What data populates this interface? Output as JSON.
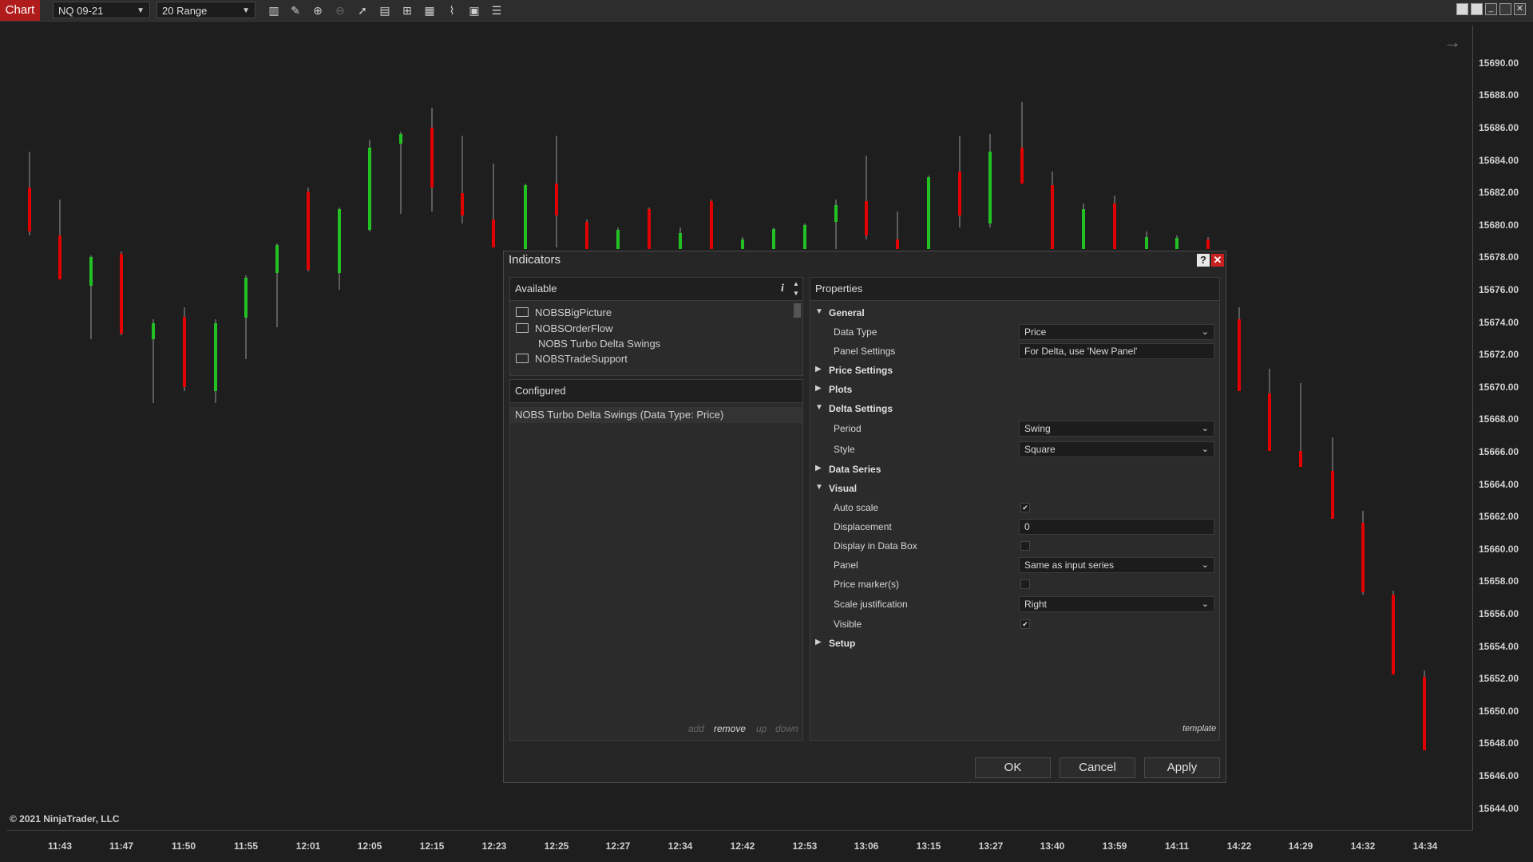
{
  "toolbar": {
    "chart_tab": "Chart",
    "instrument": "NQ 09-21",
    "interval": "20 Range",
    "icons": [
      "bars-icon",
      "draw-pencil-icon",
      "zoom-in-icon",
      "zoom-out-icon",
      "pointer-icon",
      "data-box-icon",
      "properties-icon",
      "indicators-icon",
      "strategies-icon",
      "templates-icon",
      "list-icon"
    ]
  },
  "chart": {
    "copyright": "© 2021 NinjaTrader, LLC",
    "up_color": "#22c022",
    "down_color": "#e00000",
    "price_labels": [
      "15690.00",
      "15688.00",
      "15686.00",
      "15684.00",
      "15682.00",
      "15680.00",
      "15678.00",
      "15676.00",
      "15674.00",
      "15672.00",
      "15670.00",
      "15668.00",
      "15666.00",
      "15664.00",
      "15662.00",
      "15660.00",
      "15658.00",
      "15656.00",
      "15654.00",
      "15652.00",
      "15650.00",
      "15648.00",
      "15646.00",
      "15644.00"
    ],
    "time_labels": [
      "11:43",
      "11:47",
      "11:50",
      "11:55",
      "12:01",
      "12:05",
      "12:15",
      "12:23",
      "12:25",
      "12:27",
      "12:34",
      "12:42",
      "12:53",
      "13:06",
      "13:15",
      "13:27",
      "13:40",
      "13:59",
      "14:11",
      "14:22",
      "14:29",
      "14:32",
      "14:34"
    ]
  },
  "dialog": {
    "title": "Indicators",
    "help": "?",
    "close": "✕",
    "available": {
      "header": "Available",
      "info": "i",
      "items": [
        {
          "label": "NOBSBigPicture",
          "folder": true
        },
        {
          "label": "NOBSOrderFlow",
          "folder": true
        },
        {
          "label": "NOBS Turbo Delta Swings",
          "folder": false
        },
        {
          "label": "NOBSTradeSupport",
          "folder": true
        }
      ]
    },
    "configured": {
      "header": "Configured",
      "items": [
        "NOBS Turbo Delta Swings (Data Type: Price)"
      ],
      "actions": {
        "add": "add",
        "remove": "remove",
        "up": "up",
        "down": "down"
      }
    },
    "properties": {
      "header": "Properties",
      "template": "template",
      "general": "General",
      "data_type_label": "Data Type",
      "data_type_value": "Price",
      "panel_settings_label": "Panel Settings",
      "panel_settings_value": "For Delta, use 'New Panel'",
      "price_settings": "Price Settings",
      "plots": "Plots",
      "delta_settings": "Delta Settings",
      "period_label": "Period",
      "period_value": "Swing",
      "style_label": "Style",
      "style_value": "Square",
      "data_series": "Data Series",
      "visual": "Visual",
      "auto_scale_label": "Auto scale",
      "auto_scale_checked": true,
      "displacement_label": "Displacement",
      "displacement_value": "0",
      "display_data_box_label": "Display in Data Box",
      "display_data_box_checked": false,
      "panel_label": "Panel",
      "panel_value": "Same as input series",
      "price_markers_label": "Price marker(s)",
      "price_markers_checked": false,
      "scale_just_label": "Scale justification",
      "scale_just_value": "Right",
      "visible_label": "Visible",
      "visible_checked": true,
      "setup": "Setup"
    },
    "buttons": {
      "ok": "OK",
      "cancel": "Cancel",
      "apply": "Apply"
    }
  }
}
